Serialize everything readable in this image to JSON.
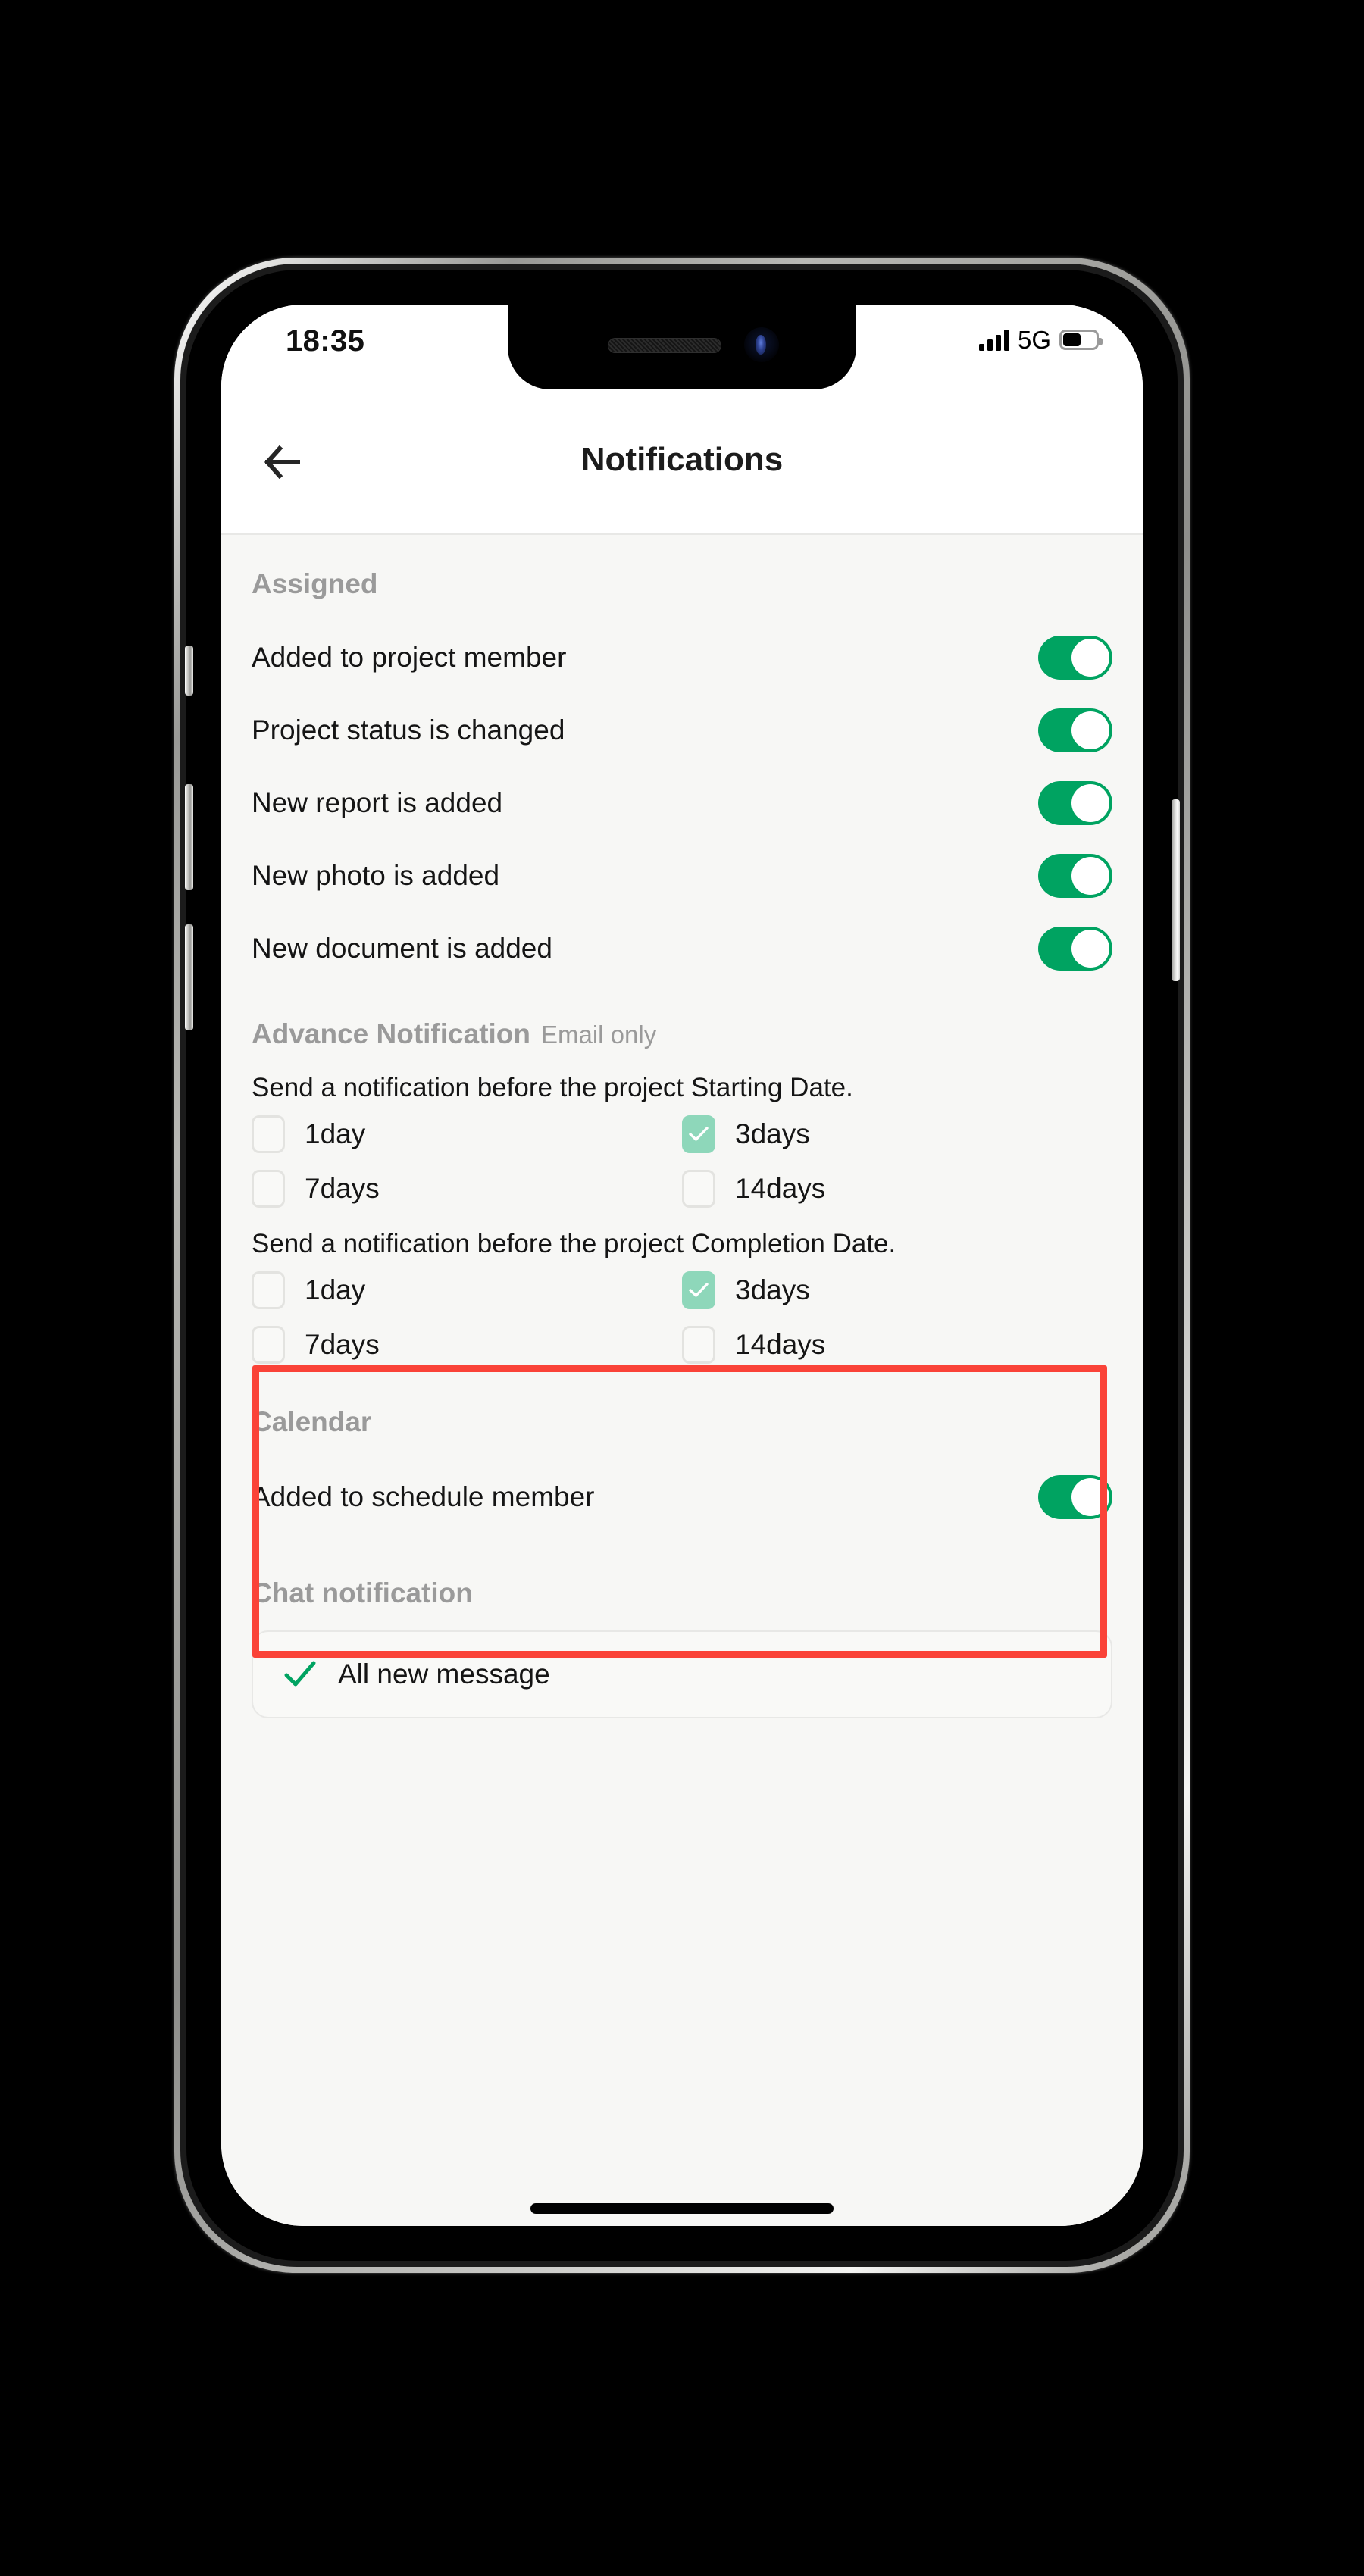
{
  "status_bar": {
    "time": "18:35",
    "network": "5G",
    "signal_icon": "signal-bars-icon",
    "battery_icon": "battery-icon",
    "battery_level_percent": 49
  },
  "header": {
    "title": "Notifications",
    "back_icon": "back-arrow-icon"
  },
  "sections": {
    "assigned": {
      "title": "Assigned",
      "rows": [
        {
          "label": "Added to project member",
          "enabled": true
        },
        {
          "label": "Project status is changed",
          "enabled": true
        },
        {
          "label": "New report is added",
          "enabled": true
        },
        {
          "label": "New photo is added",
          "enabled": true
        },
        {
          "label": "New document is added",
          "enabled": true
        }
      ]
    },
    "advance_notification": {
      "title": "Advance Notification",
      "subtitle": "Email only",
      "highlighted": true,
      "highlight_color": "#fa4338",
      "groups": [
        {
          "hint": "Send a notification before the project Starting Date.",
          "options": [
            {
              "label": "1day",
              "checked": false
            },
            {
              "label": "3days",
              "checked": true
            },
            {
              "label": "7days",
              "checked": false
            },
            {
              "label": "14days",
              "checked": false
            }
          ]
        },
        {
          "hint": "Send a notification before the project Completion Date.",
          "options": [
            {
              "label": "1day",
              "checked": false
            },
            {
              "label": "3days",
              "checked": true
            },
            {
              "label": "7days",
              "checked": false
            },
            {
              "label": "14days",
              "checked": false
            }
          ]
        }
      ]
    },
    "calendar": {
      "title": "Calendar",
      "rows": [
        {
          "label": "Added to schedule member",
          "enabled": true
        }
      ]
    },
    "chat_notification": {
      "title": "Chat notification",
      "items": [
        {
          "label": "All new message",
          "selected": true,
          "check_icon": "check-icon"
        }
      ]
    }
  },
  "colors": {
    "toggle_on": "#00a361",
    "checkbox_checked": "#8ed7ba",
    "highlight": "#fa4338",
    "check_green": "#00a361",
    "background": "#f7f7f5",
    "muted_text": "#9a9a9a"
  }
}
